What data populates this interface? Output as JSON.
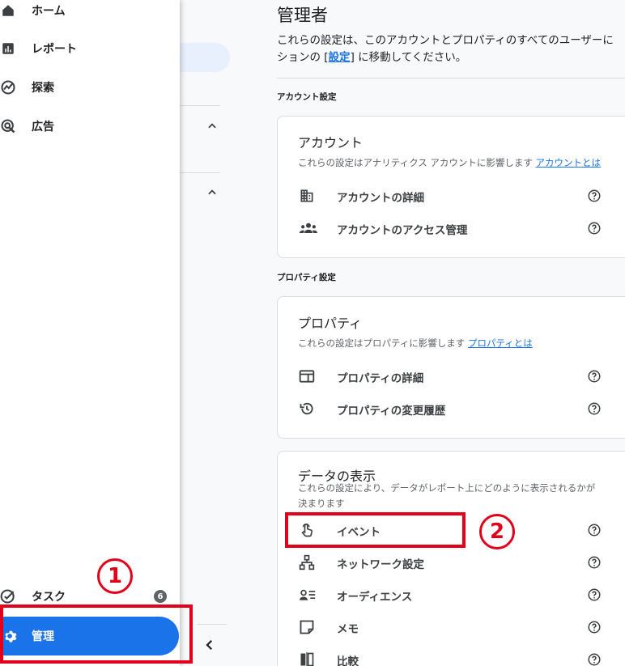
{
  "nav": {
    "items": [
      {
        "label": "ホーム",
        "icon": "home-icon"
      },
      {
        "label": "レポート",
        "icon": "reports-icon"
      },
      {
        "label": "探索",
        "icon": "explore-icon"
      },
      {
        "label": "広告",
        "icon": "advertising-icon"
      }
    ],
    "tasks_label": "タスク",
    "tasks_count": "6",
    "admin_label": "管理"
  },
  "main": {
    "title": "管理者",
    "desc_line1": "これらの設定は、このアカウントとプロパティのすべてのユーザーに",
    "desc_line2_pre": "ションの [",
    "desc_link": "設定",
    "desc_line2_post": "] に移動してください。",
    "account_section": "アカウント設定",
    "account_card": {
      "title": "アカウント",
      "desc": "これらの設定はアナリティクス アカウントに影響します",
      "link": "アカウントとは",
      "rows": [
        {
          "label": "アカウントの詳細",
          "icon": "building-icon"
        },
        {
          "label": "アカウントのアクセス管理",
          "icon": "people-icon"
        }
      ]
    },
    "property_section": "プロパティ設定",
    "property_card": {
      "title": "プロパティ",
      "desc": "これらの設定はプロパティに影響します",
      "link": "プロパティとは",
      "rows": [
        {
          "label": "プロパティの詳細",
          "icon": "property-window-icon"
        },
        {
          "label": "プロパティの変更履歴",
          "icon": "history-icon"
        }
      ]
    },
    "data_card": {
      "title": "データの表示",
      "desc": "これらの設定により、データがレポート上にどのように表示されるかが決まります",
      "rows": [
        {
          "label": "イベント",
          "icon": "touch-icon"
        },
        {
          "label": "ネットワーク設定",
          "icon": "network-icon"
        },
        {
          "label": "オーディエンス",
          "icon": "audience-icon"
        },
        {
          "label": "メモ",
          "icon": "note-icon"
        },
        {
          "label": "比較",
          "icon": "compare-icon"
        }
      ]
    }
  },
  "annotations": {
    "step1": "1",
    "step2": "2",
    "color": "#e2001a"
  },
  "colors": {
    "accent": "#1a73e8"
  }
}
